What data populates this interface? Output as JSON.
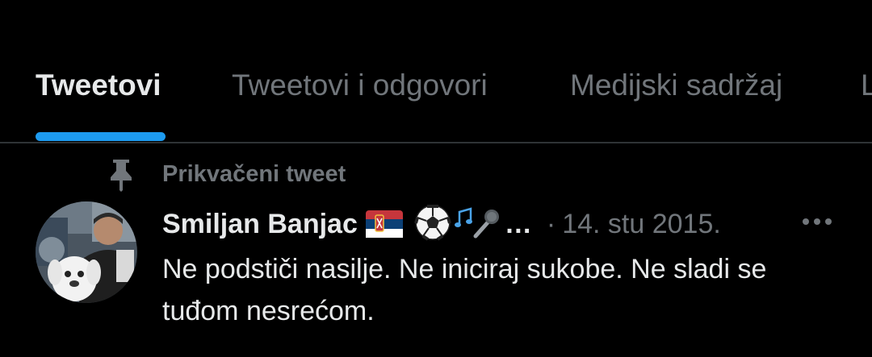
{
  "tabs": [
    {
      "label": "Tweetovi",
      "active": true
    },
    {
      "label": "Tweetovi i odgovori",
      "active": false
    },
    {
      "label": "Medijski sadržaj",
      "active": false
    },
    {
      "label": "Lajkovi",
      "active": false
    }
  ],
  "colors": {
    "background": "#000000",
    "primary_text": "#e7e9ea",
    "secondary_text": "#71767b",
    "accent": "#1d9bf0",
    "divider": "#2f3336"
  },
  "pinned": {
    "icon": "pin-icon",
    "label": "Prikvačeni tweet"
  },
  "tweet": {
    "author_name": "Smiljan Banjac",
    "name_emojis": [
      "serbia-flag-icon",
      "soccer-ball-icon",
      "musical-notes-icon",
      "microphone-icon"
    ],
    "name_ellipsis": "…",
    "separator": "·",
    "date": "14. stu 2015.",
    "text": "Ne podstiči nasilje. Ne iniciraj sukobe. Ne sladi se tuđom nesrećom.",
    "more_icon": "more-horizontal-icon",
    "avatar": "avatar-photo"
  }
}
